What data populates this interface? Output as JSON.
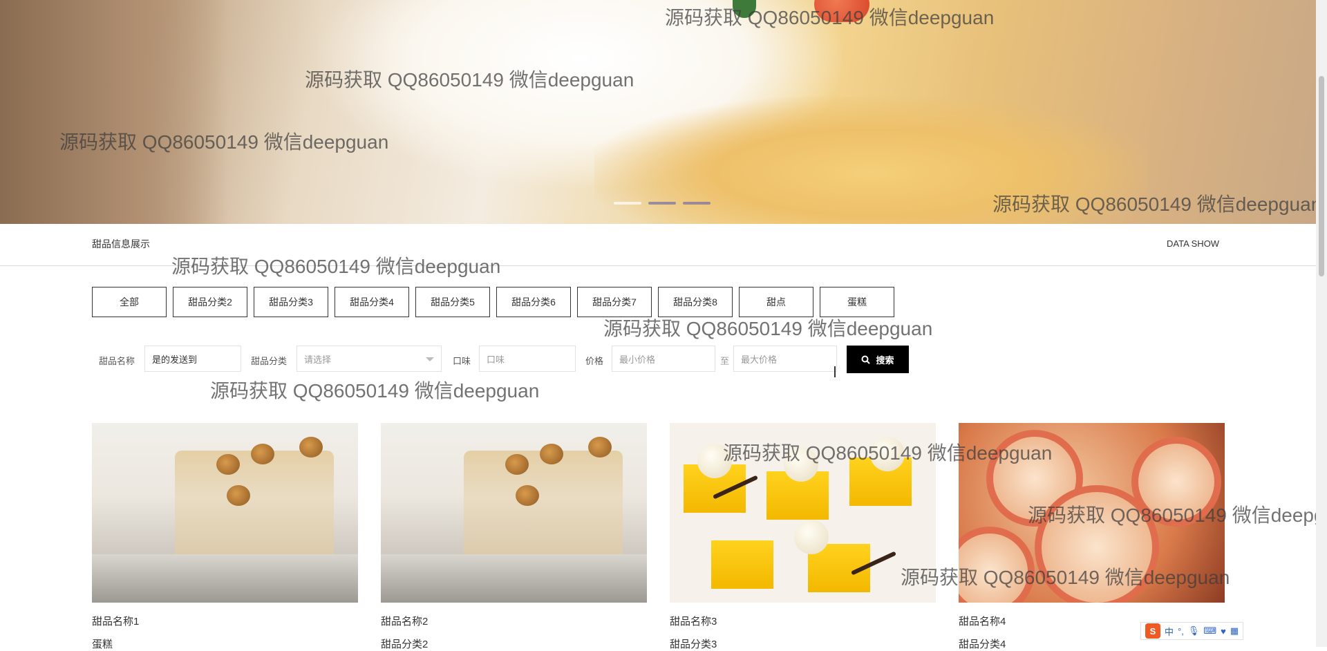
{
  "watermark_text": "源码获取 QQ86050149 微信deepguan",
  "banner": {
    "slides": 3,
    "active_slide": 2
  },
  "section": {
    "title": "甜品信息展示",
    "subtitle_en": "DATA SHOW"
  },
  "categories": [
    "全部",
    "甜品分类2",
    "甜品分类3",
    "甜品分类4",
    "甜品分类5",
    "甜品分类6",
    "甜品分类7",
    "甜品分类8",
    "甜点",
    "蛋糕"
  ],
  "search": {
    "name_label": "甜品名称",
    "name_value": "是的发送到",
    "category_label": "甜品分类",
    "category_placeholder": "请选择",
    "taste_label": "口味",
    "taste_placeholder": "口味",
    "price_label": "价格",
    "price_min_placeholder": "最小价格",
    "price_to": "至",
    "price_max_placeholder": "最大价格",
    "button_label": "搜索"
  },
  "products": [
    {
      "name": "甜品名称1",
      "category": "蛋糕",
      "image": "cake-slice"
    },
    {
      "name": "甜品名称2",
      "category": "甜品分类2",
      "image": "cake-slice"
    },
    {
      "name": "甜品名称3",
      "category": "甜品分类3",
      "image": "yellow-cubes"
    },
    {
      "name": "甜品名称4",
      "category": "甜品分类4",
      "image": "apple-roses"
    }
  ],
  "ime": {
    "logo": "S",
    "mode": "中",
    "punct": "°,",
    "icons": [
      "mic-icon",
      "keyboard-icon",
      "skin-icon",
      "grid-icon"
    ]
  },
  "colors": {
    "search_button": "#000000",
    "border": "#333333",
    "ime_logo": "#ee5a24"
  }
}
